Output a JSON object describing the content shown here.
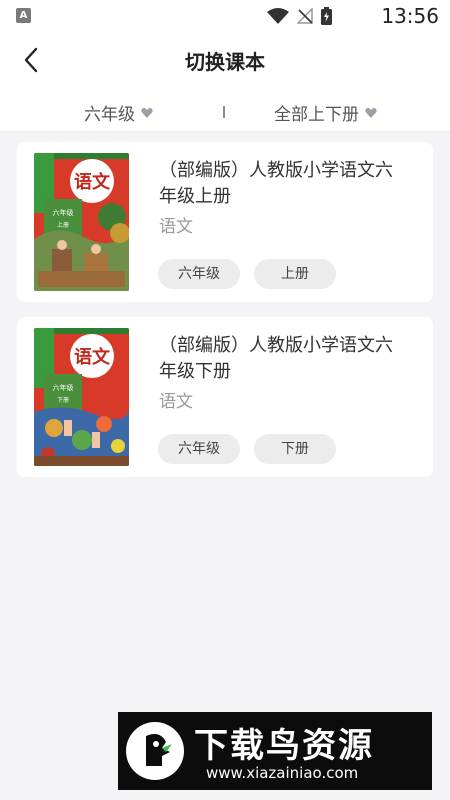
{
  "status_bar": {
    "app_icon": "A",
    "time": "13:56",
    "icons": [
      "wifi-icon",
      "no-signal-icon",
      "battery-charging-icon"
    ]
  },
  "header": {
    "title": "切换课本",
    "back_icon": "chevron-left-icon"
  },
  "filters": {
    "grade": "六年级",
    "volume": "全部上下册",
    "dropdown_icon": "heart-dropdown-icon"
  },
  "books": [
    {
      "title": "（部编版）人教版小学语文六年级上册",
      "subject": "语文",
      "grade_tag": "六年级",
      "volume_tag": "上册",
      "cover": {
        "badge": "语文",
        "grade": "六年级",
        "volume": "上册"
      }
    },
    {
      "title": "（部编版）人教版小学语文六年级下册",
      "subject": "语文",
      "grade_tag": "六年级",
      "volume_tag": "下册",
      "cover": {
        "badge": "语文",
        "grade": "六年级",
        "volume": "下册"
      }
    }
  ],
  "watermark": {
    "title": "下载鸟资源",
    "url": "www.xiazainiao.com"
  },
  "colors": {
    "background": "#f4f4f6",
    "card": "#ffffff",
    "tag": "#ececec",
    "cover_red": "#e0392c",
    "cover_green": "#3a9a3e",
    "watermark_bg": "#0c0c0c"
  }
}
